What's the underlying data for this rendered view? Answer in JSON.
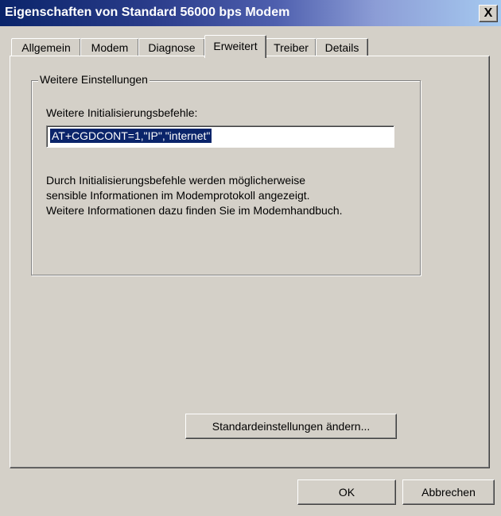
{
  "window": {
    "title": "Eigenschaften von Standard 56000 bps Modem",
    "close_label": "X"
  },
  "tabs": [
    {
      "label": "Allgemein",
      "active": false
    },
    {
      "label": "Modem",
      "active": false
    },
    {
      "label": "Diagnose",
      "active": false
    },
    {
      "label": "Erweitert",
      "active": true
    },
    {
      "label": "Treiber",
      "active": false
    },
    {
      "label": "Details",
      "active": false
    }
  ],
  "settings": {
    "group_label": "Weitere Einstellungen",
    "field_label": "Weitere Initialisierungsbefehle:",
    "init_value": "AT+CGDCONT=1,\"IP\",\"internet\"",
    "info_lines": [
      "Durch Initialisierungsbefehle werden möglicherweise",
      "sensible Informationen im Modemprotokoll angezeigt.",
      "Weitere Informationen dazu finden Sie im Modemhandbuch."
    ],
    "change_defaults_label": "Standardeinstellungen ändern..."
  },
  "footer": {
    "ok_label": "OK",
    "cancel_label": "Abbrechen"
  },
  "colors": {
    "titlebar_start": "#0a246a",
    "titlebar_end": "#a6caf0",
    "face": "#d4d0c8",
    "selection": "#0a246a"
  }
}
